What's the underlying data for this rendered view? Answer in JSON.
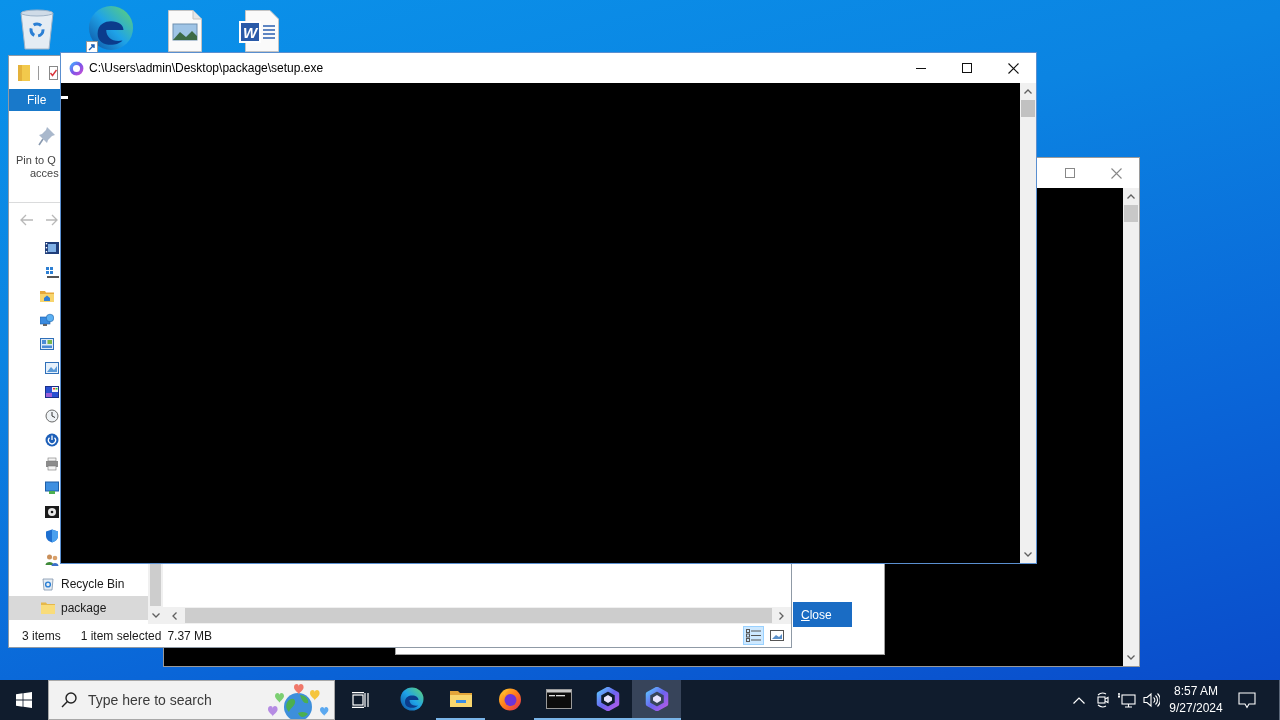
{
  "desktop": {
    "document_icon_letter": "W"
  },
  "console_window": {
    "title": "C:\\Users\\admin\\Desktop\\package\\setup.exe"
  },
  "explorer": {
    "ribbon_tab": "File",
    "pin_button": {
      "line_1": "Pin to Q",
      "line_2": "acces"
    },
    "nav_items": [
      {
        "label": "Recycle Bin",
        "selected": false
      },
      {
        "label": "package",
        "selected": true
      }
    ],
    "status_bar": {
      "item_count": "3 items",
      "selection": "1 item selected",
      "size": "7.37 MB"
    },
    "view_buttons": [
      {
        "selected": true
      },
      {
        "selected": false
      }
    ]
  },
  "dialog": {
    "close_button": "Close"
  },
  "taskbar": {
    "search": {
      "placeholder": "Type here to search"
    },
    "apps": [
      {
        "running": false,
        "selected": false
      },
      {
        "running": true,
        "selected": false
      },
      {
        "running": false,
        "selected": false
      },
      {
        "running": true,
        "selected": false
      },
      {
        "running": true,
        "selected": false
      },
      {
        "running": true,
        "selected": true
      }
    ],
    "clock": {
      "time": "8:57 AM",
      "date": "9/27/2024"
    }
  }
}
